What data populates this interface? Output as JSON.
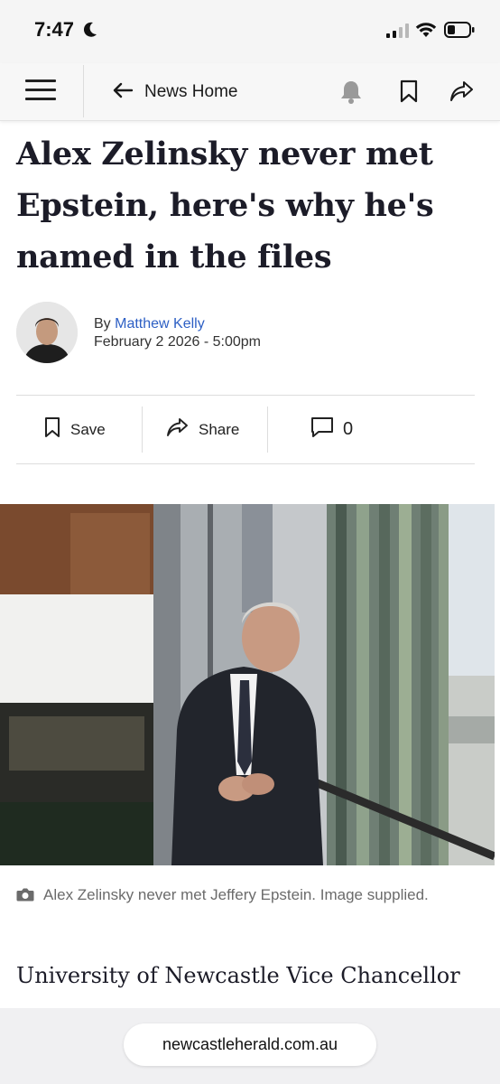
{
  "status_bar": {
    "time": "7:47"
  },
  "header": {
    "back_label": "News Home"
  },
  "article": {
    "headline": "Alex Zelinsky never met Epstein, here's why he's named in the files",
    "byline_prefix": "By",
    "author": "Matthew Kelly",
    "date": "February 2 2026 - 5:00pm",
    "actions": {
      "save_label": "Save",
      "share_label": "Share",
      "comment_count": "0"
    },
    "photo_caption": "Alex Zelinsky never met Jeffery Epstein. Image supplied.",
    "body_start": "University of Newcastle Vice Chancellor"
  },
  "browser": {
    "url": "newcastleherald.com.au"
  },
  "colors": {
    "link": "#2d5fc4",
    "headline": "#1c1c28",
    "caption": "#6b6b6b"
  }
}
